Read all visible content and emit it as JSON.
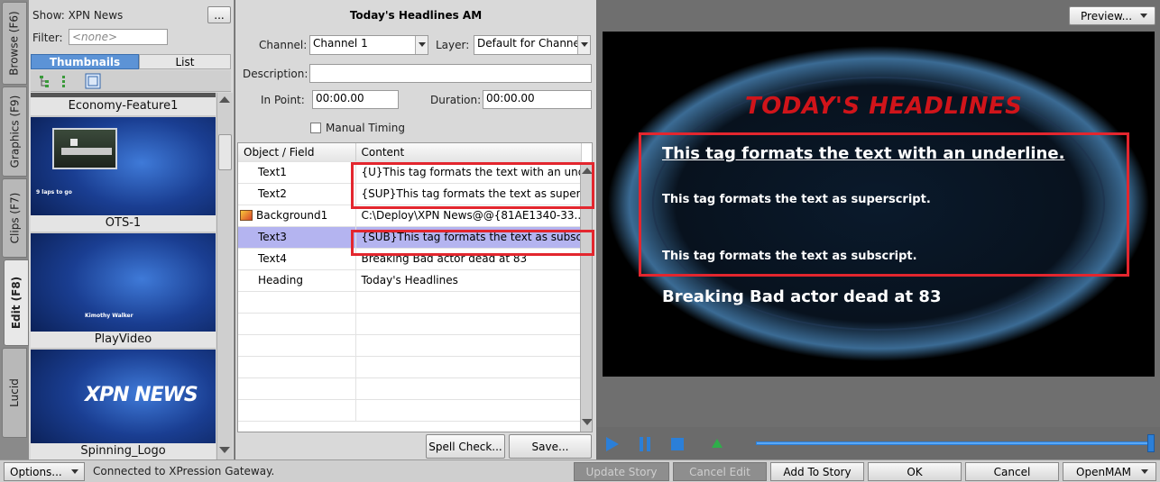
{
  "tabs": [
    {
      "label": "Browse (F6)"
    },
    {
      "label": "Graphics (F9)"
    },
    {
      "label": "Clips (F7)"
    },
    {
      "label": "Edit (F8)"
    },
    {
      "label": "Lucid"
    }
  ],
  "browser": {
    "show_label": "Show: XPN News",
    "ellipsis": "...",
    "filter_label": "Filter:",
    "filter_value": "<none>",
    "view_tabs": [
      "Thumbnails",
      "List"
    ],
    "thumbs": [
      {
        "name": "Economy-Feature1"
      },
      {
        "name": "OTS-1",
        "overlay": "9 laps to go"
      },
      {
        "name": "PlayVideo",
        "overlay": "Kimothy Walker"
      },
      {
        "name": "Spinning_Logo",
        "overlay": "XPN NEWS"
      }
    ]
  },
  "editor": {
    "title": "Today's Headlines AM",
    "channel_label": "Channel:",
    "channel_value": "Channel 1",
    "layer_label": "Layer:",
    "layer_value": "Default for Channel",
    "description_label": "Description:",
    "description_value": "",
    "in_point_label": "In Point:",
    "in_point_value": "00:00.00",
    "duration_label": "Duration:",
    "duration_value": "00:00.00",
    "manual_timing_label": "Manual Timing",
    "manual_timing_checked": false,
    "columns": [
      "Object / Field",
      "Content"
    ],
    "rows": [
      {
        "field": "Text1",
        "content": "{U}This tag formats the text with an underline.",
        "icon": ""
      },
      {
        "field": "Text2",
        "content": "{SUP}This tag formats the text as superscript.",
        "icon": ""
      },
      {
        "field": "Background1",
        "content": "C:\\Deploy\\XPN News@@{81AE1340-33...",
        "icon": "image-icon"
      },
      {
        "field": "Text3",
        "content": "{SUB}This tag formats the text as subscript.",
        "icon": ""
      },
      {
        "field": "Text4",
        "content": "Breaking Bad actor dead at 83",
        "icon": ""
      },
      {
        "field": "Heading",
        "content": "Today's Headlines",
        "icon": ""
      }
    ],
    "selected_row": 3,
    "spell_check_label": "Spell Check...",
    "save_label": "Save..."
  },
  "preview": {
    "preview_button": "Preview...",
    "heading": "TODAY'S HEADLINES",
    "line1": "This tag formats the text with an underline.",
    "line2": "This tag formats the text as superscript.",
    "line3": "This tag formats the text as subscript.",
    "line4": "Breaking Bad actor dead at 83",
    "progress_fraction": 1.0
  },
  "bottom": {
    "options_label": "Options...",
    "status": "Connected to XPression Gateway.",
    "update_story": "Update Story",
    "cancel_edit": "Cancel Edit",
    "add_to_story": "Add To Story",
    "ok": "OK",
    "cancel": "Cancel",
    "openmam": "OpenMAM"
  },
  "colors": {
    "highlight": "#e3262e",
    "accent_blue": "#2b7fd8",
    "selected_row": "#b4b4f0",
    "heading_red": "#d0141a"
  }
}
